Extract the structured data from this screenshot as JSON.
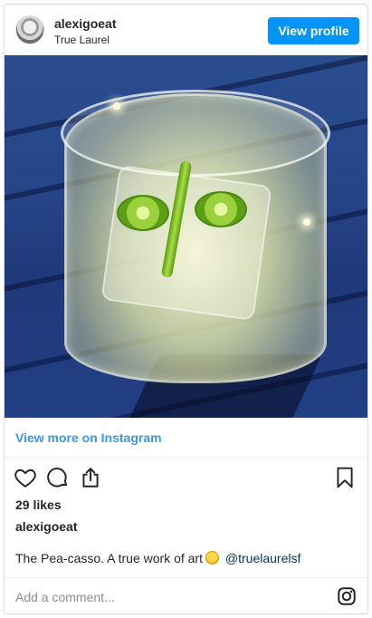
{
  "header": {
    "username": "alexigoeat",
    "location": "True Laurel",
    "view_profile_label": "View profile"
  },
  "post": {
    "view_more_label": "View more on Instagram",
    "likes": "29 likes",
    "poster": "alexigoeat",
    "caption_text": "The Pea-casso. A true work of art",
    "caption_emoji": "relieved-face-emoji",
    "mention": "@truelaurelsf"
  },
  "comment": {
    "placeholder": "Add a comment..."
  },
  "icons": {
    "like": "heart-icon",
    "comment": "comment-icon",
    "share": "share-icon",
    "save": "bookmark-icon",
    "instagram": "instagram-icon"
  },
  "colors": {
    "accent": "#0095f6",
    "link": "#3897f0",
    "text": "#262626",
    "muted": "#8e8e8e"
  }
}
